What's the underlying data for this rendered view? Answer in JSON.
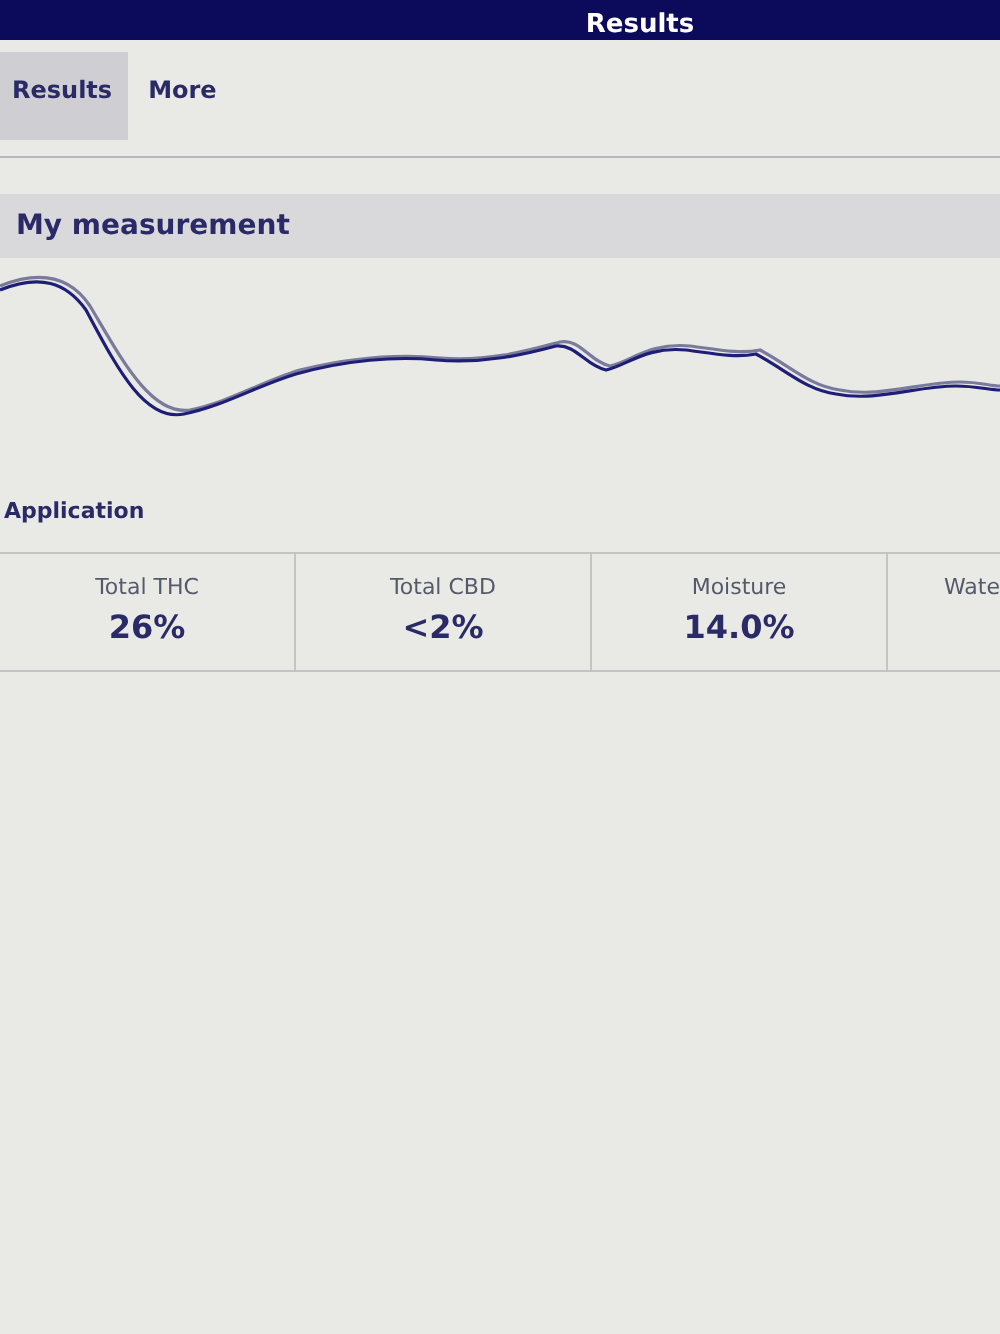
{
  "header": {
    "title": "Results"
  },
  "tabs": [
    {
      "label": "Results",
      "selected": true
    },
    {
      "label": "More",
      "selected": false
    }
  ],
  "measurement": {
    "title": "My measurement"
  },
  "application": {
    "title": "Application"
  },
  "results": [
    {
      "label": "Total THC",
      "value": "26%"
    },
    {
      "label": "Total CBD",
      "value": "<2%"
    },
    {
      "label": "Moisture",
      "value": "14.0%"
    },
    {
      "label": "Wate"
    }
  ]
}
